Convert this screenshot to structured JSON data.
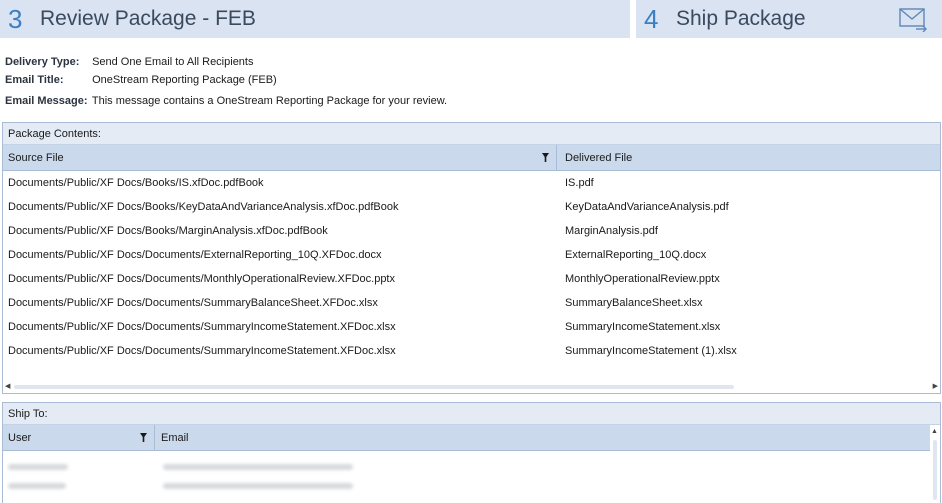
{
  "steps": [
    {
      "number": "3",
      "title": "Review Package - FEB"
    },
    {
      "number": "4",
      "title": "Ship Package"
    }
  ],
  "icons": {
    "ship": "envelope-arrow-icon",
    "filter": "filter-icon"
  },
  "details": {
    "delivery_type_label": "Delivery Type:",
    "delivery_type_value": "Send One Email to All Recipients",
    "email_title_label": "Email Title:",
    "email_title_value": "OneStream Reporting Package (FEB)",
    "email_message_label": "Email Message:",
    "email_message_value": "This message contains a OneStream Reporting Package for your review."
  },
  "package": {
    "title": "Package Contents:",
    "col_source": "Source File",
    "col_delivered": "Delivered File",
    "rows": [
      {
        "source": "Documents/Public/XF Docs/Books/IS.xfDoc.pdfBook",
        "delivered": "IS.pdf"
      },
      {
        "source": "Documents/Public/XF Docs/Books/KeyDataAndVarianceAnalysis.xfDoc.pdfBook",
        "delivered": "KeyDataAndVarianceAnalysis.pdf"
      },
      {
        "source": "Documents/Public/XF Docs/Books/MarginAnalysis.xfDoc.pdfBook",
        "delivered": "MarginAnalysis.pdf"
      },
      {
        "source": "Documents/Public/XF Docs/Documents/ExternalReporting_10Q.XFDoc.docx",
        "delivered": "ExternalReporting_10Q.docx"
      },
      {
        "source": "Documents/Public/XF Docs/Documents/MonthlyOperationalReview.XFDoc.pptx",
        "delivered": "MonthlyOperationalReview.pptx"
      },
      {
        "source": "Documents/Public/XF Docs/Documents/SummaryBalanceSheet.XFDoc.xlsx",
        "delivered": "SummaryBalanceSheet.xlsx"
      },
      {
        "source": "Documents/Public/XF Docs/Documents/SummaryIncomeStatement.XFDoc.xlsx",
        "delivered": "SummaryIncomeStatement.xlsx"
      },
      {
        "source": "Documents/Public/XF Docs/Documents/SummaryIncomeStatement.XFDoc.xlsx",
        "delivered": "SummaryIncomeStatement (1).xlsx"
      }
    ]
  },
  "ship_to": {
    "title": "Ship To:",
    "col_user": "User",
    "col_email": "Email",
    "rows_redacted": 2
  },
  "colors": {
    "accent": "#3a7fc4",
    "header_bg": "#d9e3f1",
    "grid_header_bg": "#cbd9ec",
    "border": "#a8bcd6"
  }
}
